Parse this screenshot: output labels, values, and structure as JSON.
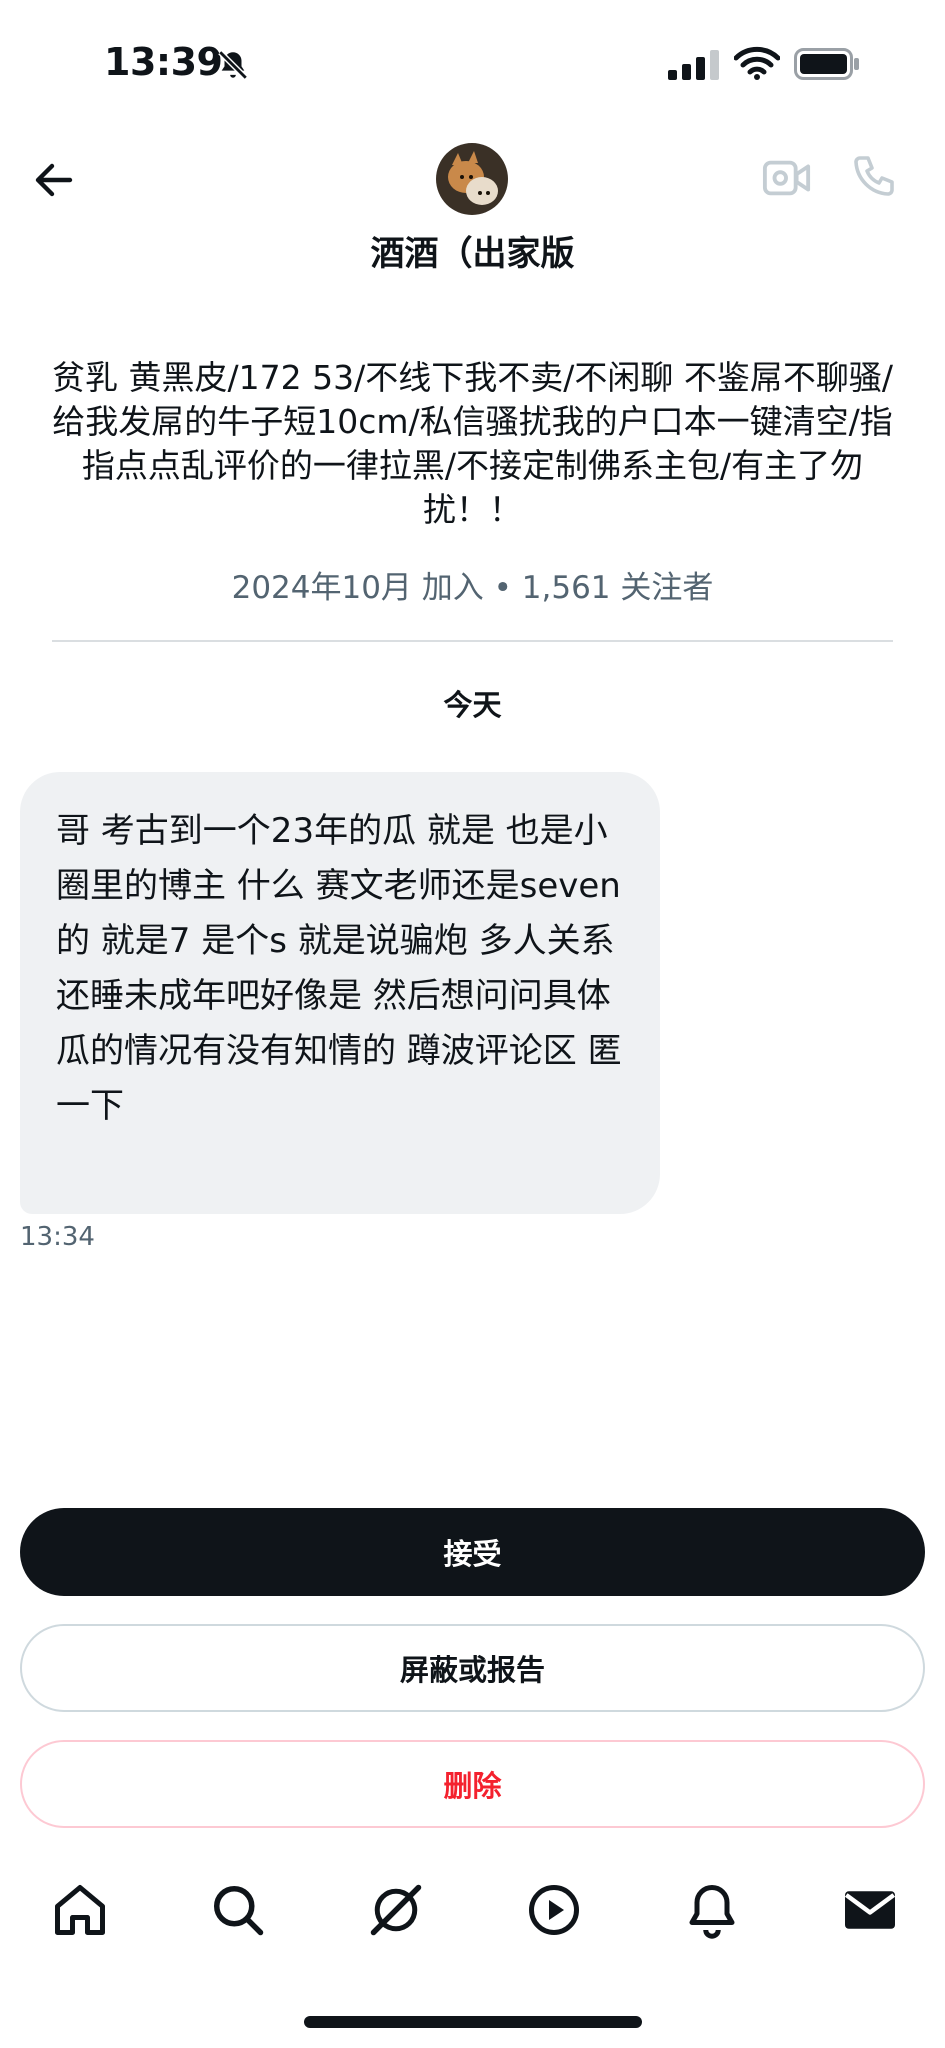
{
  "status_bar": {
    "time": "13:39"
  },
  "header": {
    "name": "酒酒（出家版"
  },
  "profile": {
    "bio": "贫乳 黄黑皮/172 53/不线下我不卖/不闲聊 不鉴屌不聊骚/给我发屌的牛子短10cm/私信骚扰我的户口本一键清空/指指点点乱评价的一律拉黑/不接定制佛系主包/有主了勿扰！！",
    "meta": "2024年10月 加入 • 1,561 关注者"
  },
  "conversation": {
    "date_label": "今天",
    "messages": [
      {
        "text": "哥 考古到一个23年的瓜 就是 也是小圈里的博主 什么 赛文老师还是seven的 就是7 是个s 就是说骗炮 多人关系 还睡未成年吧好像是 然后想问问具体瓜的情况有没有知情的 蹲波评论区 匿一下",
        "time": "13:34"
      }
    ]
  },
  "actions": {
    "accept": "接受",
    "block_report": "屏蔽或报告",
    "delete": "删除"
  },
  "colors": {
    "primary": "#0f1419",
    "secondary_text": "#536471",
    "bubble_bg": "#eff1f3",
    "danger": "#f4212e",
    "danger_border": "#fdc9d3"
  },
  "icons": [
    "back-arrow-icon",
    "video-call-icon",
    "phone-call-icon",
    "home-icon",
    "search-icon",
    "grok-icon",
    "play-icon",
    "bell-icon",
    "mail-icon"
  ]
}
